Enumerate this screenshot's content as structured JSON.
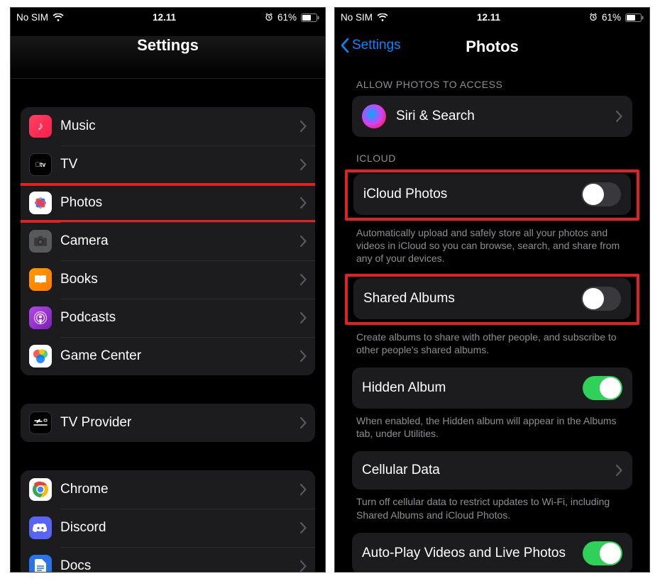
{
  "status": {
    "carrier": "No SIM",
    "time": "12.11",
    "battery_pct": "61%"
  },
  "colors": {
    "highlight": "#e12222",
    "accent": "#0a84ff",
    "toggle_on": "#30d158"
  },
  "left": {
    "title": "Settings",
    "group1": [
      {
        "id": "music",
        "label": "Music"
      },
      {
        "id": "tv",
        "label": "TV"
      },
      {
        "id": "photos",
        "label": "Photos"
      },
      {
        "id": "camera",
        "label": "Camera"
      },
      {
        "id": "books",
        "label": "Books"
      },
      {
        "id": "podcasts",
        "label": "Podcasts"
      },
      {
        "id": "gamecenter",
        "label": "Game Center"
      }
    ],
    "group2": [
      {
        "id": "tvprovider",
        "label": "TV Provider"
      }
    ],
    "group3": [
      {
        "id": "chrome",
        "label": "Chrome"
      },
      {
        "id": "discord",
        "label": "Discord"
      },
      {
        "id": "docs",
        "label": "Docs"
      }
    ]
  },
  "right": {
    "back": "Settings",
    "title": "Photos",
    "allow_header": "ALLOW PHOTOS TO ACCESS",
    "siri_label": "Siri & Search",
    "icloud_header": "ICLOUD",
    "icloud_photos": {
      "label": "iCloud Photos",
      "on": false
    },
    "icloud_footer": "Automatically upload and safely store all your photos and videos in iCloud so you can browse, search, and share from any of your devices.",
    "shared_albums": {
      "label": "Shared Albums",
      "on": false
    },
    "shared_footer": "Create albums to share with other people, and subscribe to other people's shared albums.",
    "hidden": {
      "label": "Hidden Album",
      "on": true
    },
    "hidden_footer": "When enabled, the Hidden album will appear in the Albums tab, under Utilities.",
    "cellular": {
      "label": "Cellular Data"
    },
    "cellular_footer": "Turn off cellular data to restrict updates to Wi-Fi, including Shared Albums and iCloud Photos.",
    "autoplay": {
      "label": "Auto-Play Videos and Live Photos",
      "on": true
    }
  }
}
